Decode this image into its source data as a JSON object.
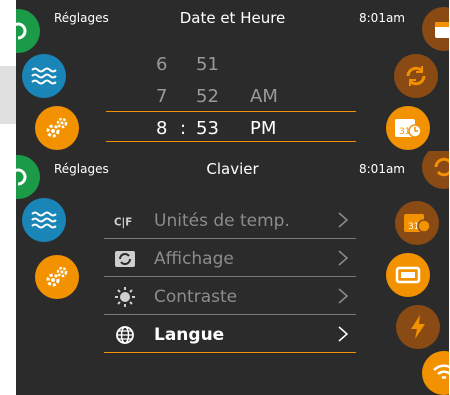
{
  "screen1": {
    "header": {
      "left": "Réglages",
      "title": "Date et Heure",
      "time": "8:01am"
    },
    "picker": {
      "rows": [
        {
          "hour": "6",
          "minute": "51",
          "ampm": ""
        },
        {
          "hour": "7",
          "minute": "52",
          "ampm": "AM"
        },
        {
          "hour": "8",
          "minute": "53",
          "ampm": "PM"
        }
      ],
      "separator": ":"
    }
  },
  "screen2": {
    "header": {
      "left": "Réglages",
      "title": "Clavier",
      "time": "8:01am"
    },
    "menu": [
      {
        "label": "Unités de temp.",
        "icon": "celsius-fahrenheit-icon"
      },
      {
        "label": "Affichage",
        "icon": "rotate-display-icon"
      },
      {
        "label": "Contraste",
        "icon": "sun-icon"
      },
      {
        "label": "Langue",
        "icon": "globe-icon"
      }
    ],
    "icon_glyphs": {
      "cf": "C|F",
      "cal": "31"
    }
  },
  "colors": {
    "accent": "#f39200",
    "background": "#2b2b2b",
    "green": "#1b9a47",
    "blue": "#1a86b8",
    "brown": "#8a4a14"
  }
}
